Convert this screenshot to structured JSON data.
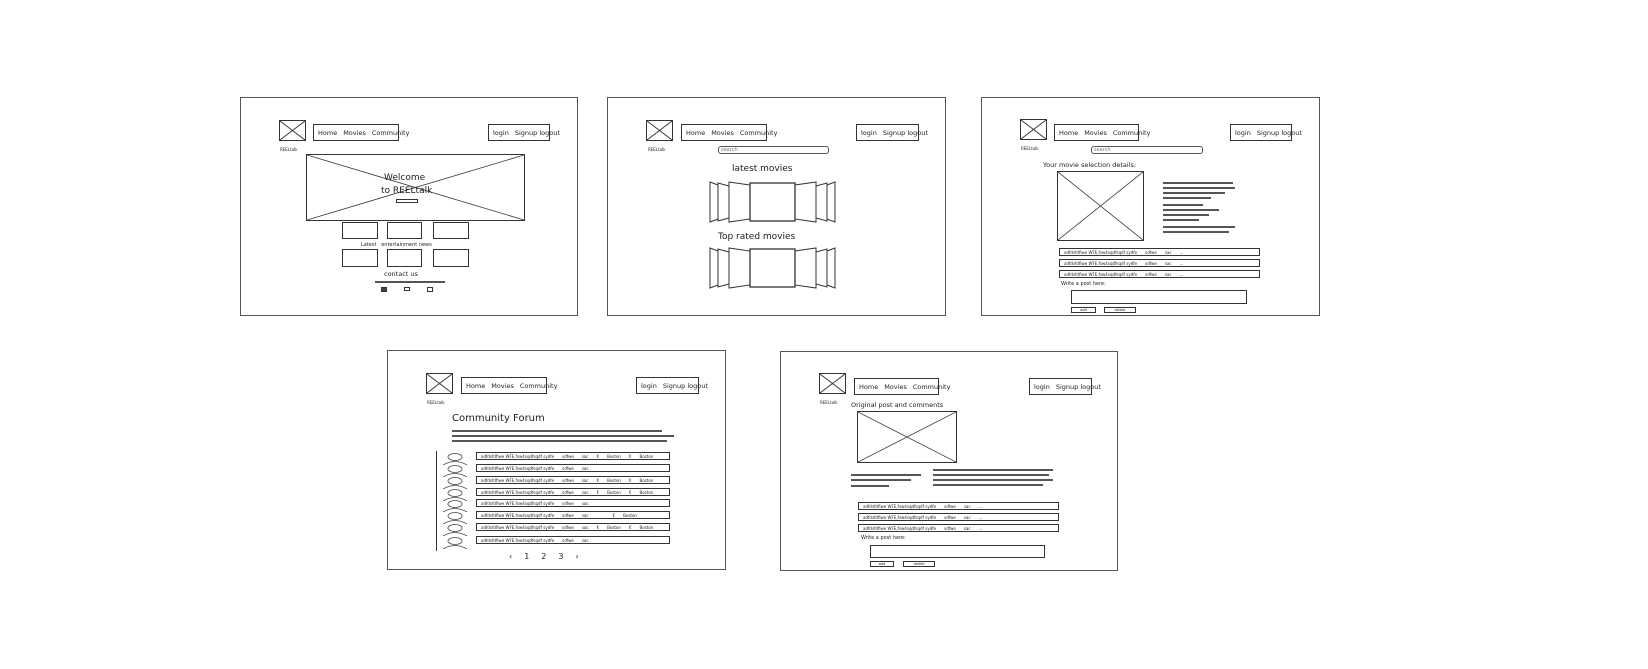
{
  "nav": {
    "home": "Home",
    "movies": "Movies",
    "community": "Community",
    "login": "login",
    "signup_logout": "Signup logout"
  },
  "logo_caption": "REELtalk",
  "search_placeholder": "search",
  "home": {
    "welcome_line1": "Welcome",
    "welcome_line2": "to REELtalk",
    "latest_news": "Latest   entertainment news",
    "contact_us": "contact us"
  },
  "movies": {
    "latest": "latest movies",
    "top_rated": "Top rated movies"
  },
  "details": {
    "title": "Your movie selection details:",
    "write_post": "Write a post here:",
    "rows": [
      {
        "a": "adfdsfdfiwe WFE,fsw4sqdfsqdf sydfe",
        "b": "sdfwe",
        "c": "sac",
        "d": "..."
      },
      {
        "a": "adfdsfdfiwe WFE,fsw4sqdfsqdf sydfe",
        "b": "sdfwe",
        "c": "sac",
        "d": "..."
      },
      {
        "a": "adfdsfdfiwe WFE,fsw4sqdfsqdf sydfe",
        "b": "sdfwe",
        "c": "sac",
        "d": "..."
      }
    ],
    "btn_add": "add",
    "btn_delete": "delete"
  },
  "forum": {
    "title": "Community Forum",
    "rows": [
      {
        "a": "adfdsfdfiwe WFE,fsw4sqdfsqdf sydfe",
        "b": "sdfwe",
        "c": "sac",
        "d": "€",
        "e": "Boston",
        "f": "€",
        "g": "Boston"
      },
      {
        "a": "adfdsfdfiwe WFE,fsw4sqdfsqdf sydfe",
        "b": "sdfwe",
        "c": "sac",
        "d": "",
        "e": "",
        "f": "",
        "g": ""
      },
      {
        "a": "adfdsfdfiwe WFE,fsw4sqdfsqdf sydfe",
        "b": "sdfwe",
        "c": "sac",
        "d": "€",
        "e": "Boston",
        "f": "€",
        "g": "Boston"
      },
      {
        "a": "adfdsfdfiwe WFE,fsw4sqdfsqdf sydfe",
        "b": "sdfwe",
        "c": "sac",
        "d": "€",
        "e": "Boston",
        "f": "€",
        "g": "Boston"
      },
      {
        "a": "adfdsfdfiwe WFE,fsw4sqdfsqdf sydfe",
        "b": "sdfwe",
        "c": "sac",
        "d": "",
        "e": "",
        "f": "",
        "g": ""
      },
      {
        "a": "adfdsfdfiwe WFE,fsw4sqdfsqdf sydfe",
        "b": "sdfwe",
        "c": "sac",
        "d": "",
        "e": "",
        "f": "€",
        "g": "Boston"
      },
      {
        "a": "adfdsfdfiwe WFE,fsw4sqdfsqdf sydfe",
        "b": "sdfwe",
        "c": "sac",
        "d": "€",
        "e": "Boston",
        "f": "€",
        "g": "Boston"
      },
      {
        "a": "adfdsfdfiwe WFE,fsw4sqdfsqdf sydfe",
        "b": "sdfwe",
        "c": "sac",
        "d": "",
        "e": "",
        "f": "",
        "g": ""
      }
    ],
    "pagination": {
      "prev": "‹",
      "p1": "1",
      "p2": "2",
      "p3": "3",
      "next": "›"
    }
  },
  "post": {
    "title": "Original post and comments",
    "write_post": "Write a post here:",
    "rows": [
      {
        "a": "adfdsfdfiwe WFE,fsw4sqdfsqdf sydfe",
        "b": "sdfwe",
        "c": "sac",
        "d": "..."
      },
      {
        "a": "adfdsfdfiwe WFE,fsw4sqdfsqdf sydfe",
        "b": "sdfwe",
        "c": "sac",
        "d": "..."
      },
      {
        "a": "adfdsfdfiwe WFE,fsw4sqdfsqdf sydfe",
        "b": "sdfwe",
        "c": "sac",
        "d": "..."
      }
    ],
    "btn_add": "add",
    "btn_delete": "delete"
  }
}
